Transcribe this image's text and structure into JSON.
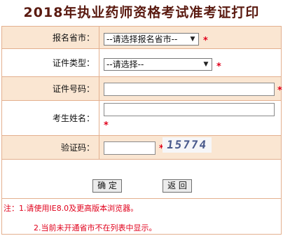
{
  "page": {
    "title": "2018年执业药师资格考试准考证打印"
  },
  "form": {
    "province": {
      "label": "报名省市：",
      "selected": "--请选择报名省市--",
      "required": "*"
    },
    "id_type": {
      "label": "证件类型：",
      "selected": "--请选择--",
      "required": "*"
    },
    "id_number": {
      "label": "证件号码：",
      "value": "",
      "required": "*"
    },
    "name": {
      "label": "考生姓名：",
      "value": "",
      "required": "*"
    },
    "captcha": {
      "label": "验证码：",
      "value": "",
      "required": "*",
      "image_text": "15774"
    }
  },
  "buttons": {
    "confirm": "确 定",
    "back": "返 回"
  },
  "notes": {
    "line1": "注：1.请使用IE8.0及更高版本浏览器。",
    "line2": "2.当前未开通省市不在列表中显示。"
  },
  "icons": {
    "dropdown": "chevron-down-icon"
  },
  "colors": {
    "title": "#5a1a10",
    "row_tan": "#fae6d2",
    "border": "#e3b08f",
    "required": "#e0001b"
  }
}
